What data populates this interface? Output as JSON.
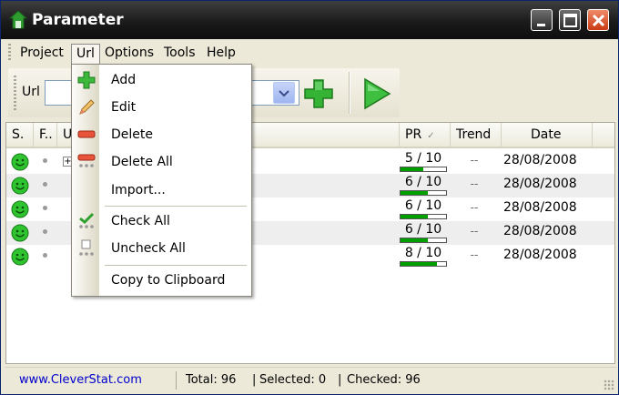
{
  "window": {
    "title": "Parameter"
  },
  "menubar": {
    "items": [
      "Project",
      "Url",
      "Options",
      "Tools",
      "Help"
    ]
  },
  "toolbar": {
    "url_label": "Url",
    "url_value": ""
  },
  "url_menu": {
    "items": [
      {
        "label": "Add",
        "icon": "add-icon"
      },
      {
        "label": "Edit",
        "icon": "pencil-icon"
      },
      {
        "label": "Delete",
        "icon": "delete-icon"
      },
      {
        "label": "Delete All",
        "icon": "delete-all-icon"
      },
      {
        "label": "Import...",
        "icon": ""
      },
      {
        "label": "Check All",
        "icon": "check-all-icon"
      },
      {
        "label": "Uncheck All",
        "icon": "uncheck-all-icon"
      },
      {
        "label": "Copy to Clipboard",
        "icon": ""
      }
    ]
  },
  "columns": [
    "S.",
    "F..",
    "U",
    "PR",
    "Trend",
    "Date"
  ],
  "rows": [
    {
      "pr": "5 / 10",
      "pr_value": 5,
      "trend": "--",
      "date": "28/08/2008"
    },
    {
      "pr": "6 / 10",
      "pr_value": 6,
      "trend": "--",
      "date": "28/08/2008"
    },
    {
      "pr": "6 / 10",
      "pr_value": 6,
      "trend": "--",
      "date": "28/08/2008"
    },
    {
      "pr": "6 / 10",
      "pr_value": 6,
      "trend": "--",
      "date": "28/08/2008"
    },
    {
      "pr": "8 / 10",
      "pr_value": 8,
      "trend": "--",
      "date": "28/08/2008"
    }
  ],
  "statusbar": {
    "link": "www.CleverStat.com",
    "total": "Total: 96",
    "selected": "Selected: 0",
    "checked": "Checked: 96"
  },
  "colors": {
    "accent_green": "#00a000",
    "link_blue": "#0000cc",
    "titlebar": "#1b1b1b"
  }
}
